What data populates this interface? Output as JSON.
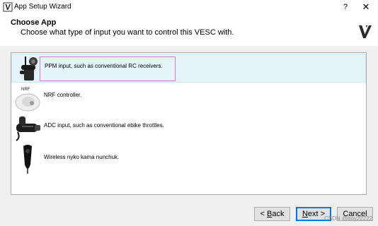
{
  "window": {
    "title": "App Setup Wizard",
    "help_symbol": "?",
    "close_symbol": "✕",
    "icon": "vesc-logo-icon"
  },
  "header": {
    "title": "Choose App",
    "subtitle": "Choose what type of input you want to control this VESC with.",
    "logo": "vesc-logo-icon"
  },
  "apps": [
    {
      "label": "PPM input, such as conventional RC receivers.",
      "icon": "rc-transmitter-icon",
      "selected": true
    },
    {
      "label": "NRF controller.",
      "icon": "nrf-remote-icon",
      "icon_caption": "NRF",
      "selected": false
    },
    {
      "label": "ADC input, such as conventional ebike throttles.",
      "icon": "ebike-throttle-icon",
      "selected": false
    },
    {
      "label": "Wireless nyko kama nunchuk.",
      "icon": "nunchuk-icon",
      "selected": false
    }
  ],
  "buttons": {
    "back_prefix": "< ",
    "back_mnemonic": "B",
    "back_rest": "ack",
    "next_prefix": "",
    "next_mnemonic": "N",
    "next_rest": "ext >",
    "cancel": "Cancel"
  },
  "watermark": "CSDN @boy22222"
}
